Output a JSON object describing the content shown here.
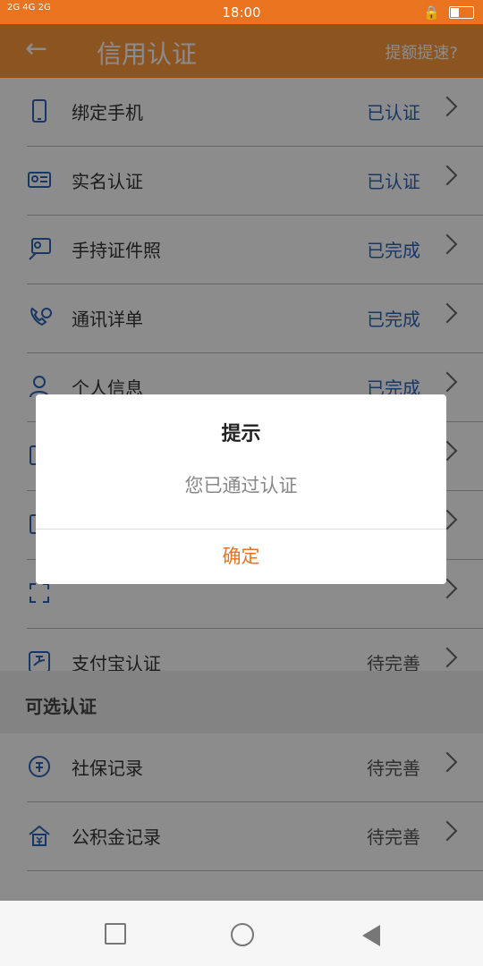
{
  "status_bar": {
    "left_text": "2G 4G 2G",
    "time": "18:00"
  },
  "app_bar": {
    "title": "信用认证",
    "right_link": "提额提速?"
  },
  "items": [
    {
      "name": "绑定手机",
      "status": "已认证",
      "icon": "phone-icon",
      "status_color": "#2d64b8"
    },
    {
      "name": "实名认证",
      "status": "已认证",
      "icon": "id-card-icon",
      "status_color": "#2d64b8"
    },
    {
      "name": "手持证件照",
      "status": "已完成",
      "icon": "person-card-icon",
      "status_color": "#2d64b8"
    },
    {
      "name": "通讯详单",
      "status": "已完成",
      "icon": "phone-call-icon",
      "status_color": "#2d64b8"
    },
    {
      "name": "个人信息",
      "status": "已完成",
      "icon": "person-icon",
      "status_color": "#2d64b8"
    },
    {
      "name": "",
      "status": "",
      "icon": "hidden-icon"
    },
    {
      "name": "",
      "status": "",
      "icon": "hidden-icon"
    },
    {
      "name": "",
      "status": "",
      "icon": "hidden-icon"
    },
    {
      "name": "支付宝认证",
      "status": "待完善",
      "icon": "alipay-icon",
      "status_color": "#555555"
    }
  ],
  "section": {
    "label": "可选认证"
  },
  "optional_items": [
    {
      "name": "社保记录",
      "status": "待完善",
      "icon": "social-security-icon"
    },
    {
      "name": "公积金记录",
      "status": "待完善",
      "icon": "housing-fund-icon"
    }
  ],
  "dialog": {
    "title": "提示",
    "message": "您已通过认证",
    "confirm": "确定"
  },
  "colors": {
    "accent": "#ff9a3c",
    "statusbar": "#e9731f",
    "link_blue": "#2d64b8"
  }
}
